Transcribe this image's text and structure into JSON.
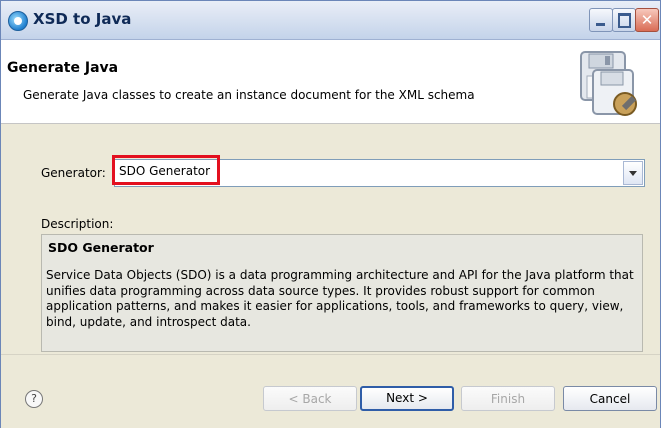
{
  "window": {
    "title": "XSD to Java"
  },
  "banner": {
    "title": "Generate Java",
    "description": "Generate Java classes to create an instance document for the XML schema"
  },
  "generator": {
    "label": "Generator:",
    "selected": "SDO Generator"
  },
  "description": {
    "label": "Description:",
    "title": "SDO Generator",
    "body": "Service Data Objects (SDO) is a data programming architecture and API for the Java platform that unifies data programming across data source types. It provides robust support for common application patterns, and makes it easier for applications, tools, and frameworks to query, view, bind, update, and introspect data."
  },
  "footer": {
    "help_glyph": "?",
    "back_label": "< Back",
    "next_label": "Next >",
    "finish_label": "Finish",
    "cancel_label": "Cancel"
  },
  "colors": {
    "highlight": "#e3101f",
    "accent": "#2f5da8"
  }
}
